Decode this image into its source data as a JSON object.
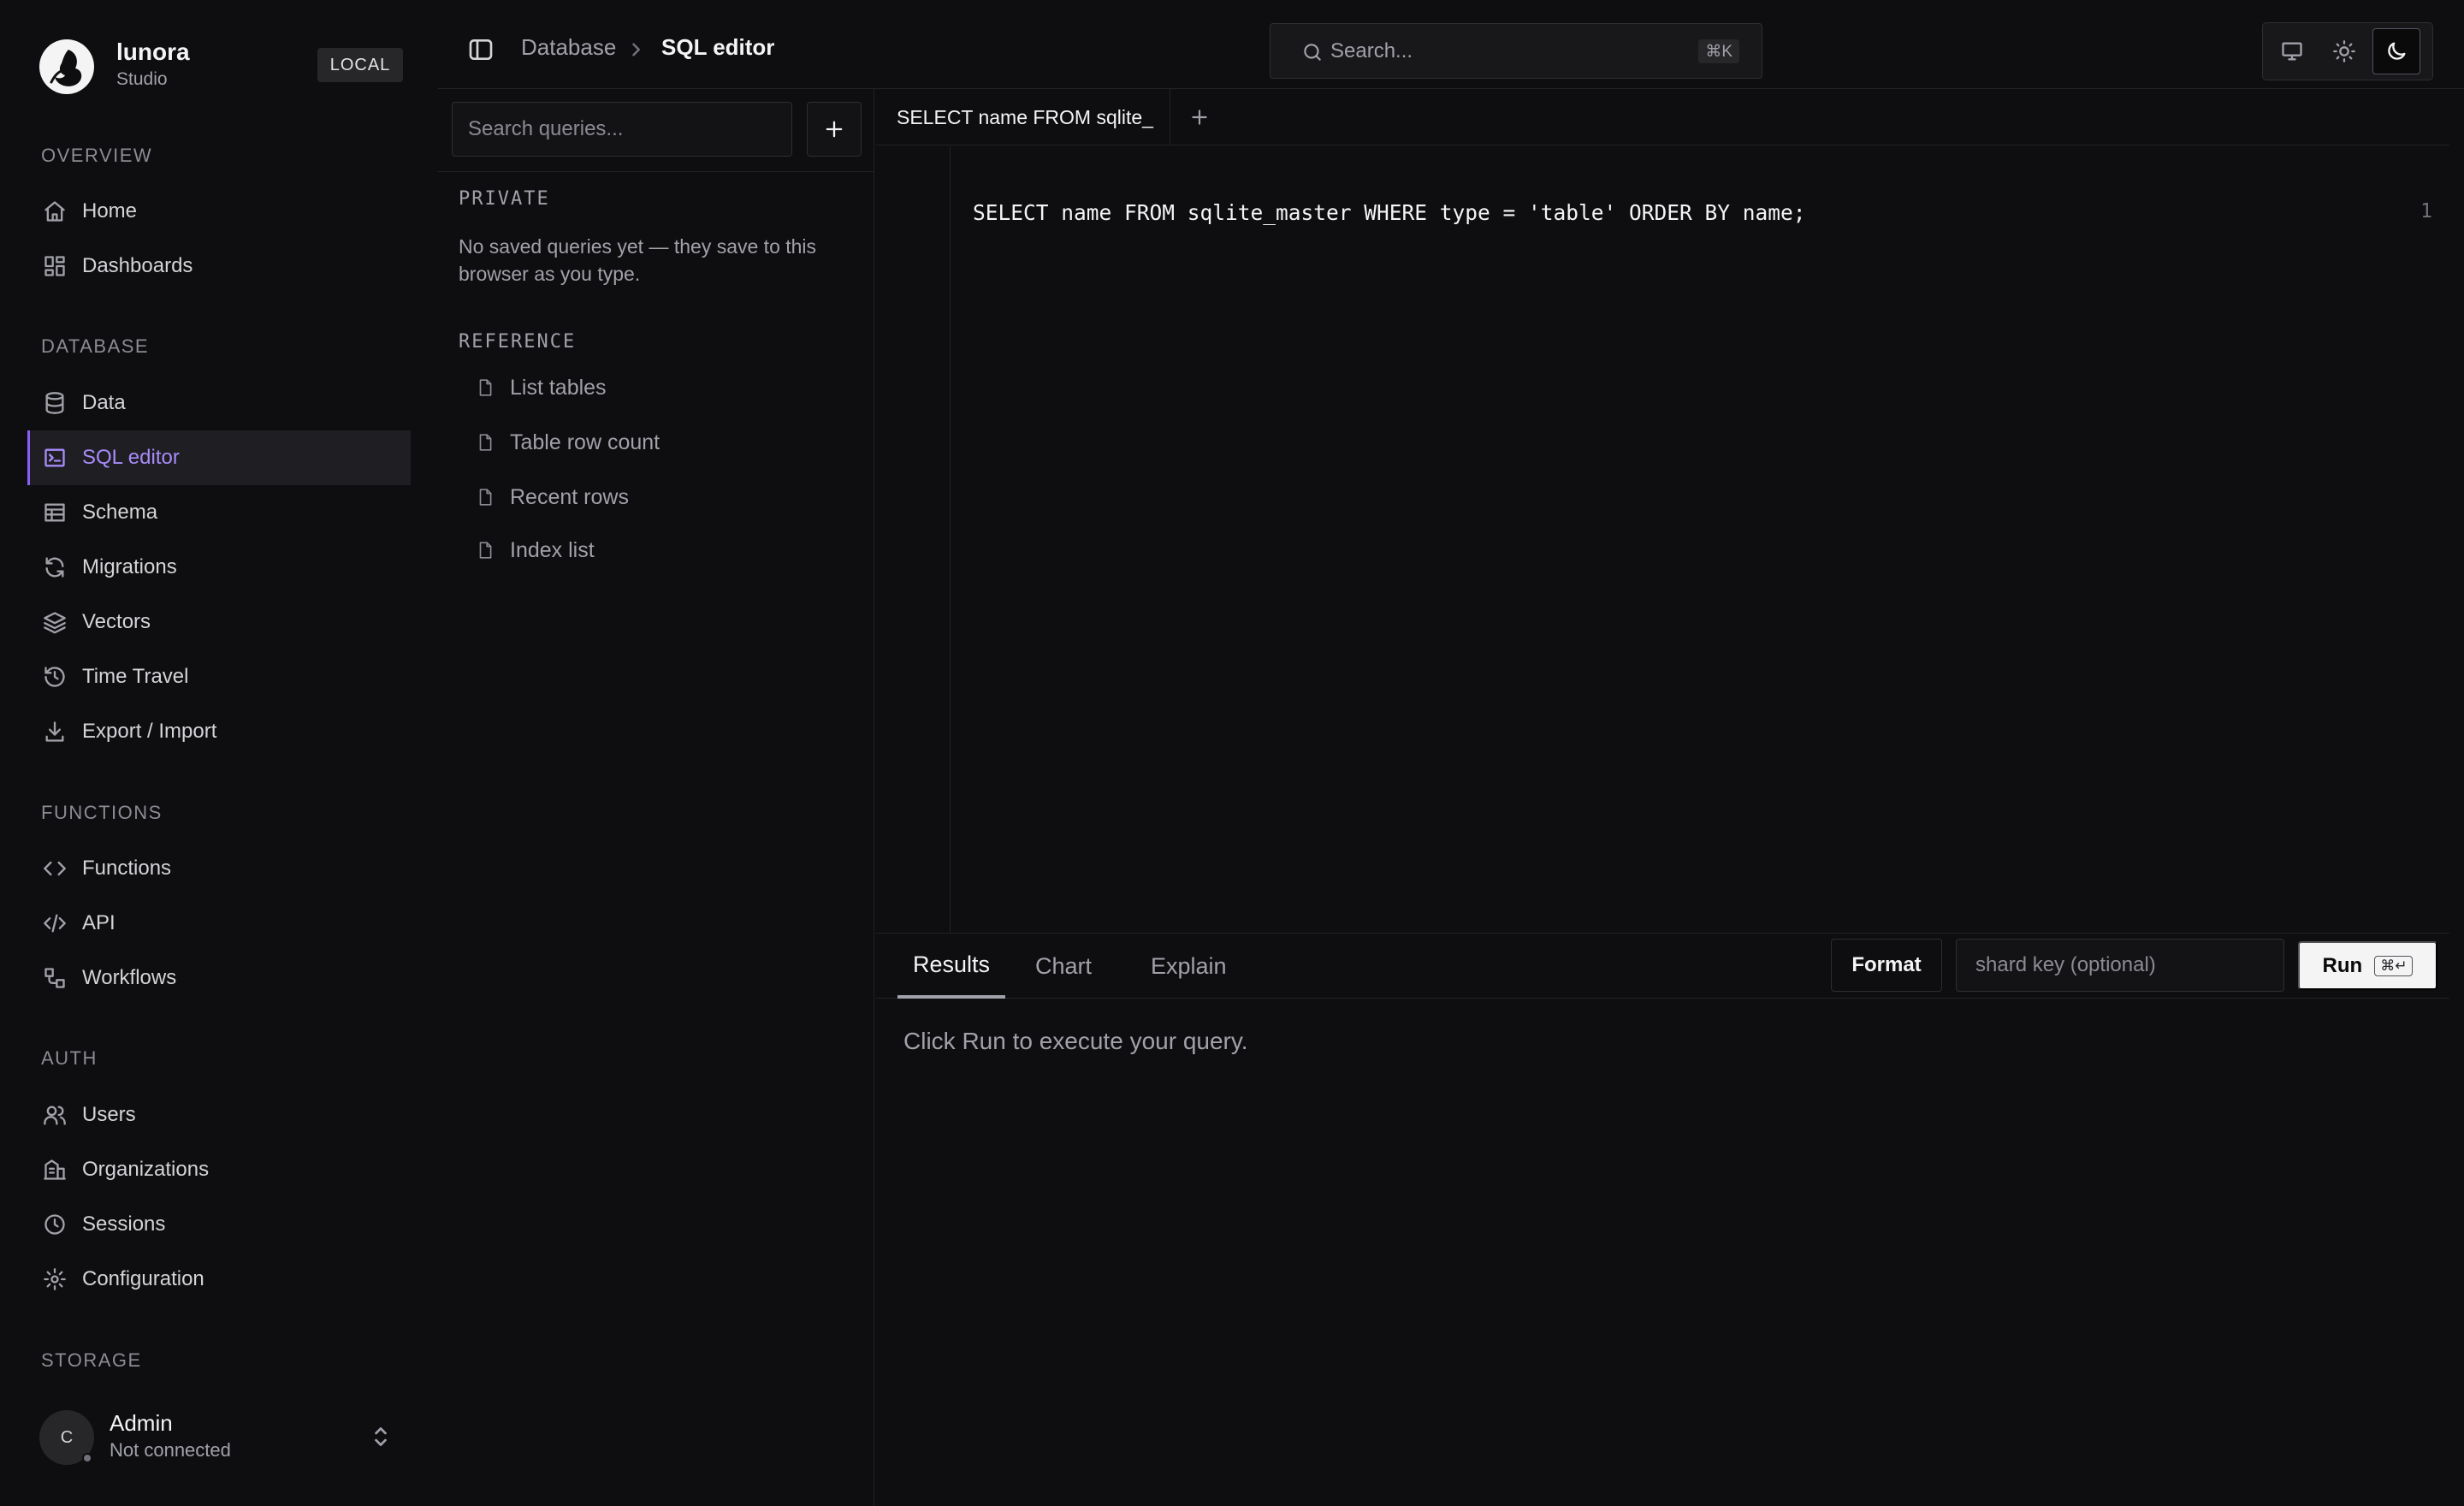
{
  "sidebar": {
    "brand": {
      "name": "lunora",
      "subtitle": "Studio",
      "env_badge": "LOCAL"
    },
    "sections": [
      {
        "label": "OVERVIEW",
        "items": [
          {
            "label": "Home",
            "icon": "home-icon"
          },
          {
            "label": "Dashboards",
            "icon": "dashboard-icon"
          }
        ]
      },
      {
        "label": "DATABASE",
        "items": [
          {
            "label": "Data",
            "icon": "database-icon"
          },
          {
            "label": "SQL editor",
            "icon": "terminal-icon",
            "active": true
          },
          {
            "label": "Schema",
            "icon": "table-icon"
          },
          {
            "label": "Migrations",
            "icon": "refresh-icon"
          },
          {
            "label": "Vectors",
            "icon": "layers-icon"
          },
          {
            "label": "Time Travel",
            "icon": "history-icon"
          },
          {
            "label": "Export / Import",
            "icon": "download-icon"
          }
        ]
      },
      {
        "label": "FUNCTIONS",
        "items": [
          {
            "label": "Functions",
            "icon": "code-icon"
          },
          {
            "label": "API",
            "icon": "api-icon"
          },
          {
            "label": "Workflows",
            "icon": "workflow-icon"
          }
        ]
      },
      {
        "label": "AUTH",
        "items": [
          {
            "label": "Users",
            "icon": "users-icon"
          },
          {
            "label": "Organizations",
            "icon": "building-icon"
          },
          {
            "label": "Sessions",
            "icon": "clock-icon"
          },
          {
            "label": "Configuration",
            "icon": "gear-icon"
          }
        ]
      },
      {
        "label": "STORAGE",
        "items": []
      }
    ],
    "user": {
      "initial": "C",
      "name": "Admin",
      "status": "Not connected"
    }
  },
  "topbar": {
    "breadcrumb": [
      "Database",
      "SQL editor"
    ],
    "search": {
      "placeholder": "Search...",
      "shortcut": "⌘K"
    },
    "theme_options": [
      "monitor-icon",
      "sun-icon",
      "moon-icon"
    ],
    "active_theme": "dark"
  },
  "queries_panel": {
    "search_placeholder": "Search queries...",
    "private_label": "PRIVATE",
    "private_empty": "No saved queries yet — they save to this browser as you type.",
    "reference_label": "REFERENCE",
    "reference_items": [
      "List tables",
      "Table row count",
      "Recent rows",
      "Index list"
    ]
  },
  "editor": {
    "tab_title": "SELECT name FROM sqlite_",
    "line_number": "1",
    "code": "SELECT name FROM sqlite_master WHERE type = 'table' ORDER BY name;"
  },
  "results": {
    "tabs": [
      "Results",
      "Chart",
      "Explain"
    ],
    "active_tab": "Results",
    "format_label": "Format",
    "shard_placeholder": "shard key (optional)",
    "run_label": "Run",
    "run_shortcut": "⌘↵",
    "empty_message": "Click Run to execute your query."
  },
  "colors": {
    "background": "#0e0e10",
    "accent": "#a78bfa",
    "active_bg": "#1f1f23",
    "border": "#222226"
  }
}
